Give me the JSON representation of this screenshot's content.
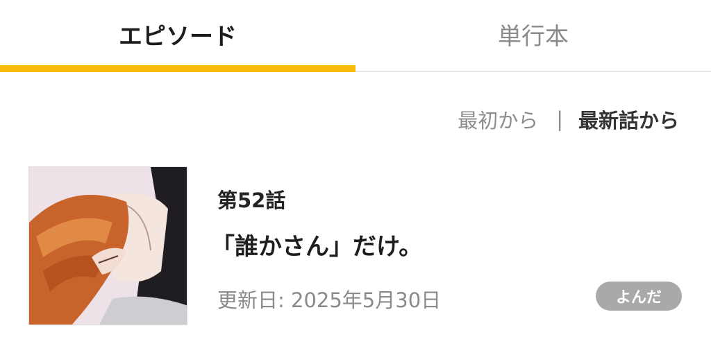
{
  "tabs": [
    {
      "label": "エピソード",
      "active": true
    },
    {
      "label": "単行本",
      "active": false
    }
  ],
  "colors": {
    "accent": "#f8bd0b",
    "badge_bg": "#a9a9a9",
    "muted_text": "#8a8a8a"
  },
  "sort": {
    "from_first": "最初から",
    "divider": "|",
    "from_latest": "最新話から",
    "selected": "from_latest"
  },
  "episode": {
    "thumbnail_icon": "manga-cover-thumbnail",
    "number": "第52話",
    "title": "「誰かさん」だけ。",
    "updated": "更新日: 2025年5月30日",
    "status_badge": "よんだ"
  }
}
